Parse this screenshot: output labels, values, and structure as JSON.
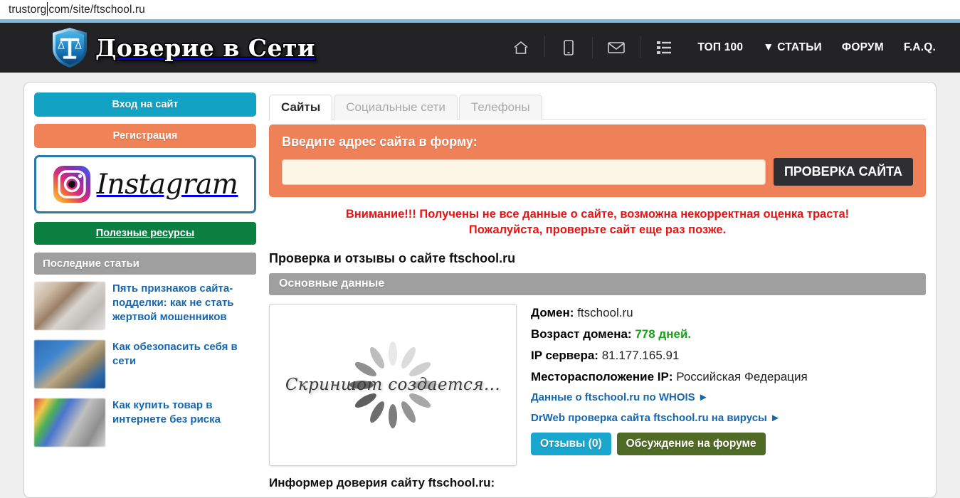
{
  "browser": {
    "url_before_caret": "trustorg",
    "url_after_caret": "com/site/ftschool.ru"
  },
  "header": {
    "logo_text": "Доверие в Сети",
    "logo_letter": "T",
    "icons": [
      {
        "name": "home-icon"
      },
      {
        "name": "mobile-icon"
      },
      {
        "name": "envelope-icon"
      },
      {
        "name": "list-icon"
      }
    ],
    "links": [
      {
        "label": "ТОП 100"
      },
      {
        "label": "▼ СТАТЬИ"
      },
      {
        "label": "ФОРУМ"
      },
      {
        "label": "F.A.Q."
      }
    ]
  },
  "sidebar": {
    "login_label": "Вход на сайт",
    "register_label": "Регистрация",
    "instagram_label": "Instagram",
    "resources_label": "Полезные ресурсы",
    "articles_header": "Последние статьи",
    "articles": [
      {
        "title": "Пять признаков сайта-подделки: как не стать жертвой мошенников"
      },
      {
        "title": "Как обезопасить себя в сети"
      },
      {
        "title": "Как купить товар в интернете без риска"
      }
    ]
  },
  "main": {
    "tabs": [
      {
        "label": "Сайты",
        "active": true
      },
      {
        "label": "Социальные сети",
        "active": false
      },
      {
        "label": "Телефоны",
        "active": false
      }
    ],
    "search": {
      "label": "Введите адрес сайта в форму:",
      "value": "",
      "placeholder": "",
      "button_label": "ПРОВЕРКА САЙТА"
    },
    "warning_line1": "Внимание!!! Получены не все данные о сайте, возможна некорректная оценка траста!",
    "warning_line2": "Пожалуйста, проверьте сайт еще раз позже.",
    "page_title": "Проверка и отзывы о сайте ftschool.ru",
    "section_title": "Основные данные",
    "screenshot_placeholder": "Скриншот создается...",
    "details": {
      "domain_label": "Домен:",
      "domain_value": "ftschool.ru",
      "age_label": "Возраст домена:",
      "age_value": "778 дней.",
      "ip_label": "IP сервера:",
      "ip_value": "81.177.165.91",
      "location_label": "Месторасположение IP:",
      "location_value": "Российская Федерация",
      "whois_link": "Данные о ftschool.ru по WHOIS ►",
      "drweb_link": "DrWeb проверка сайта ftschool.ru на вирусы ►",
      "reviews_button": "Отзывы (0)",
      "forum_button": "Обсуждение на форуме"
    },
    "informer_title": "Информер доверия сайту ftschool.ru:"
  },
  "colors": {
    "header_bg": "#232326",
    "blue_rule": "#7fb9e0",
    "accent_orange": "#ef8159",
    "accent_teal": "#11a2c4",
    "accent_green": "#0b8040",
    "warning_red": "#ee1111",
    "link_blue": "#1667ad",
    "green_value": "#1aa018",
    "forum_olive": "#4f6b25"
  }
}
